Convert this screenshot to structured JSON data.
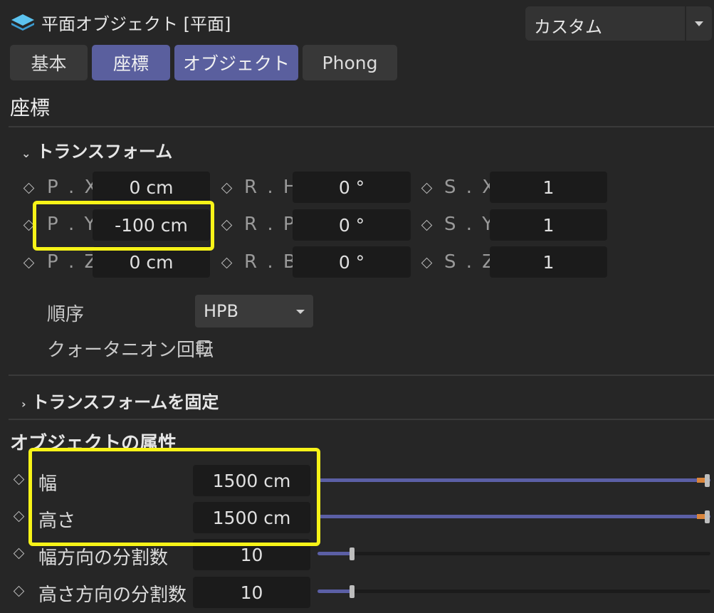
{
  "header": {
    "title": "平面オブジェクト [平面]",
    "preset": "カスタム",
    "object_icon": "plane-object-icon"
  },
  "tabs": [
    {
      "label": "基本",
      "active": false
    },
    {
      "label": "座標",
      "active": true
    },
    {
      "label": "オブジェクト",
      "active": true
    },
    {
      "label": "Phong",
      "active": false
    }
  ],
  "coord_section": {
    "title": "座標",
    "transform_group": "トランスフォーム",
    "rows": [
      {
        "p_label": "P . X",
        "p_value": "0 cm",
        "r_label": "R . H",
        "r_value": "0 °",
        "s_label": "S . X",
        "s_value": "1"
      },
      {
        "p_label": "P . Y",
        "p_value": "-100 cm",
        "r_label": "R . P",
        "r_value": "0 °",
        "s_label": "S . Y",
        "s_value": "1"
      },
      {
        "p_label": "P . Z",
        "p_value": "0 cm",
        "r_label": "R . B",
        "r_value": "0 °",
        "s_label": "S . Z",
        "s_value": "1"
      }
    ],
    "order_label": "順序",
    "order_value": "HPB",
    "quaternion_label": "クォータニオン回転",
    "quaternion_checked": false,
    "freeze_group": "トランスフォームを固定"
  },
  "object_props": {
    "title": "オブジェクトの属性",
    "params": [
      {
        "label": "幅",
        "value": "1500 cm",
        "slider_fraction": 1.0
      },
      {
        "label": "高さ",
        "value": "1500 cm",
        "slider_fraction": 1.0
      },
      {
        "label": "幅方向の分割数",
        "value": "10",
        "slider_fraction": 0.09
      },
      {
        "label": "高さ方向の分割数",
        "value": "10",
        "slider_fraction": 0.09
      }
    ]
  },
  "colors": {
    "background": "#262626",
    "active_tab": "#5a5f9e",
    "slider_fill": "#5b5fa5",
    "slider_max_marker": "#d9853b",
    "highlight": "#f7f318"
  }
}
